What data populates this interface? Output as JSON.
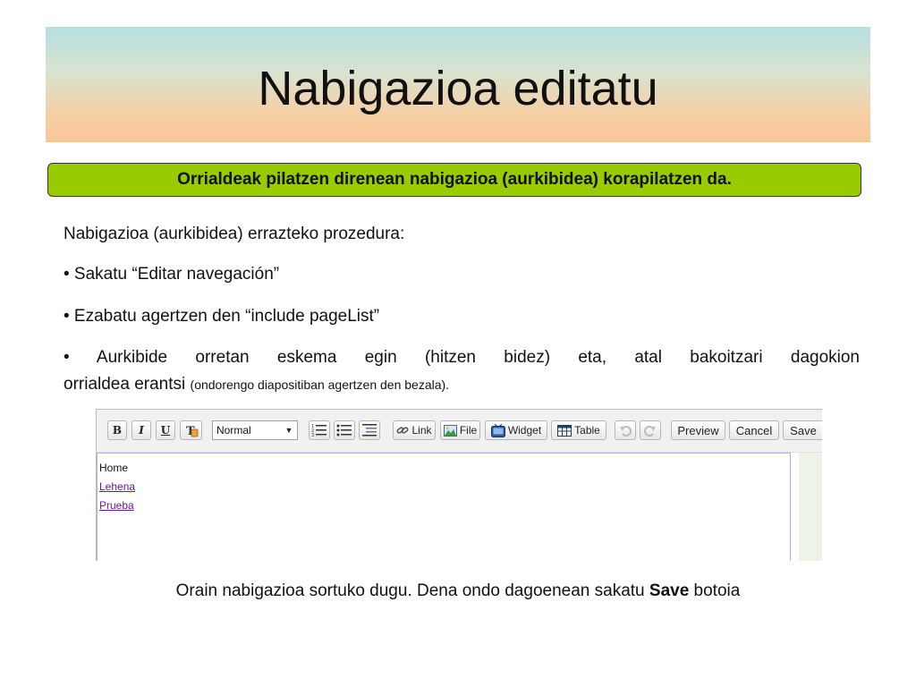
{
  "slide": {
    "title": "Nabigazioa editatu",
    "banner": "Orrialdeak pilatzen direnean nabigazioa (aurkibidea) korapilatzen da.",
    "intro": "Nabigazioa (aurkibidea) errazteko prozedura:",
    "bullets": [
      "• Sakatu “Editar navegación”",
      "• Ezabatu agertzen den  “include pageList”",
      "• Aurkibide orretan eskema egin (hitzen bidez) eta, atal bakoitzari dagokion"
    ],
    "bullet3_cont": "orrialdea erantsi",
    "bullet3_note": "(ondorengo diapositiban agertzen den bezala).",
    "footer_pre": "Orain nabigazioa sortuko dugu. Dena ondo dagoenean sakatu ",
    "footer_bold": "Save",
    "footer_post": " botoia"
  },
  "editor": {
    "toolbar": {
      "bold": "B",
      "italic": "I",
      "underline": "U",
      "format_select": "Normal",
      "link": "Link",
      "file": "File",
      "widget": "Widget",
      "table": "Table",
      "preview": "Preview",
      "cancel": "Cancel",
      "save": "Save"
    },
    "content": {
      "line1": "Home",
      "link1": "Lehena",
      "link2": "Prueba"
    }
  },
  "colors": {
    "banner_bg": "#99cc00",
    "link": "#6a1a9a"
  }
}
